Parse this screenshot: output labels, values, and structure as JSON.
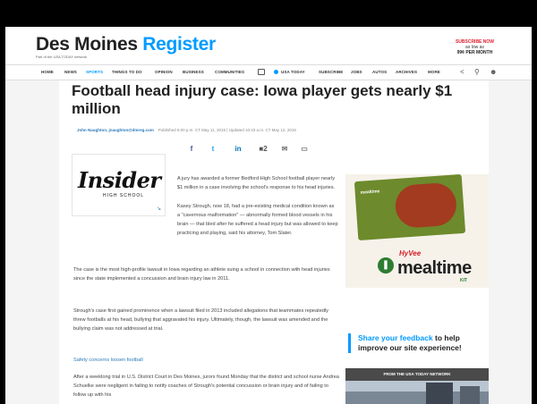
{
  "masthead": {
    "logo_first": "Des Moines",
    "logo_second": "Register",
    "tagline": "Part of the USA TODAY network",
    "subscribe_line1": "SUBSCRIBE NOW",
    "subscribe_line2": "as low as",
    "subscribe_line3": "99¢ PER MONTH"
  },
  "nav": {
    "items": [
      "HOME",
      "NEWS",
      "SPORTS",
      "THINGS TO DO",
      "OPINION",
      "BUSINESS",
      "COMMUNITIES"
    ],
    "active": "SPORTS",
    "usa_today": "USA TODAY",
    "items_right": [
      "SUBSCRIBE",
      "JOBS",
      "AUTOS",
      "ARCHIVES",
      "MORE"
    ]
  },
  "article": {
    "headline": "Football head injury case: Iowa player gets nearly $1 million",
    "author": "John Naughton, jnaughton@dmreg.com",
    "published": "Published 6:00 p.m. CT May 11, 2015 | Updated 10:43 a.m. CT May 12, 2015",
    "share": [
      {
        "icon": "f",
        "count": "",
        "color": "#3b5998"
      },
      {
        "icon": "t",
        "count": "",
        "color": "#1da1f2"
      },
      {
        "icon": "in",
        "count": "",
        "color": "#0077b5"
      },
      {
        "icon": "💬",
        "count": "2",
        "color": "#555555"
      },
      {
        "icon": "✉",
        "count": "",
        "color": "#777777"
      },
      {
        "icon": "▭",
        "count": "",
        "color": "#777777"
      }
    ],
    "insider_word": "Insider",
    "insider_sub": "HIGH SCHOOL",
    "paragraphs": [
      "A jury has awarded a former Bedford High School football player nearly $1 million in a case involving the school's response to his head injuries.",
      "Kasey Strough, now 18, had a pre-existing medical condition known as a \"cavernous malformation\" — abnormally formed blood vessels in his brain — that bled after he suffered a head injury but was allowed to keep practicing and playing, said his attorney, Tom Slater.",
      "The case is the most high-profile lawsuit in Iowa regarding an athlete suing a school in connection with head injuries since the state implemented a concussion and brain injury law in 2011.",
      "Strough's case first gained prominence when a lawsuit filed in 2013 included allegations that teammates repeatedly threw footballs at his head, bullying that aggravated his injury. Ultimately, though, the lawsuit was amended and the bullying claim was not addressed at trial.",
      "After a weeklong trial in U.S. District Court in Des Moines, jurors found Monday that the district and school nurse Andrea Schuelke were negligent in failing to notify coaches of Strough's potential concussion or brain injury and of failing to follow up with his"
    ],
    "related_link": "Safety concerns loosen football"
  },
  "ad": {
    "hyvee": "HyVee",
    "mealtime": "mealtime",
    "kit": "KIT",
    "box_label": "mealtime"
  },
  "sidebar": {
    "feedback_link": "Share your feedback",
    "feedback_text": "to help improve our site experience!",
    "usa_network": "FROM THE USA TODAY NETWORK"
  }
}
